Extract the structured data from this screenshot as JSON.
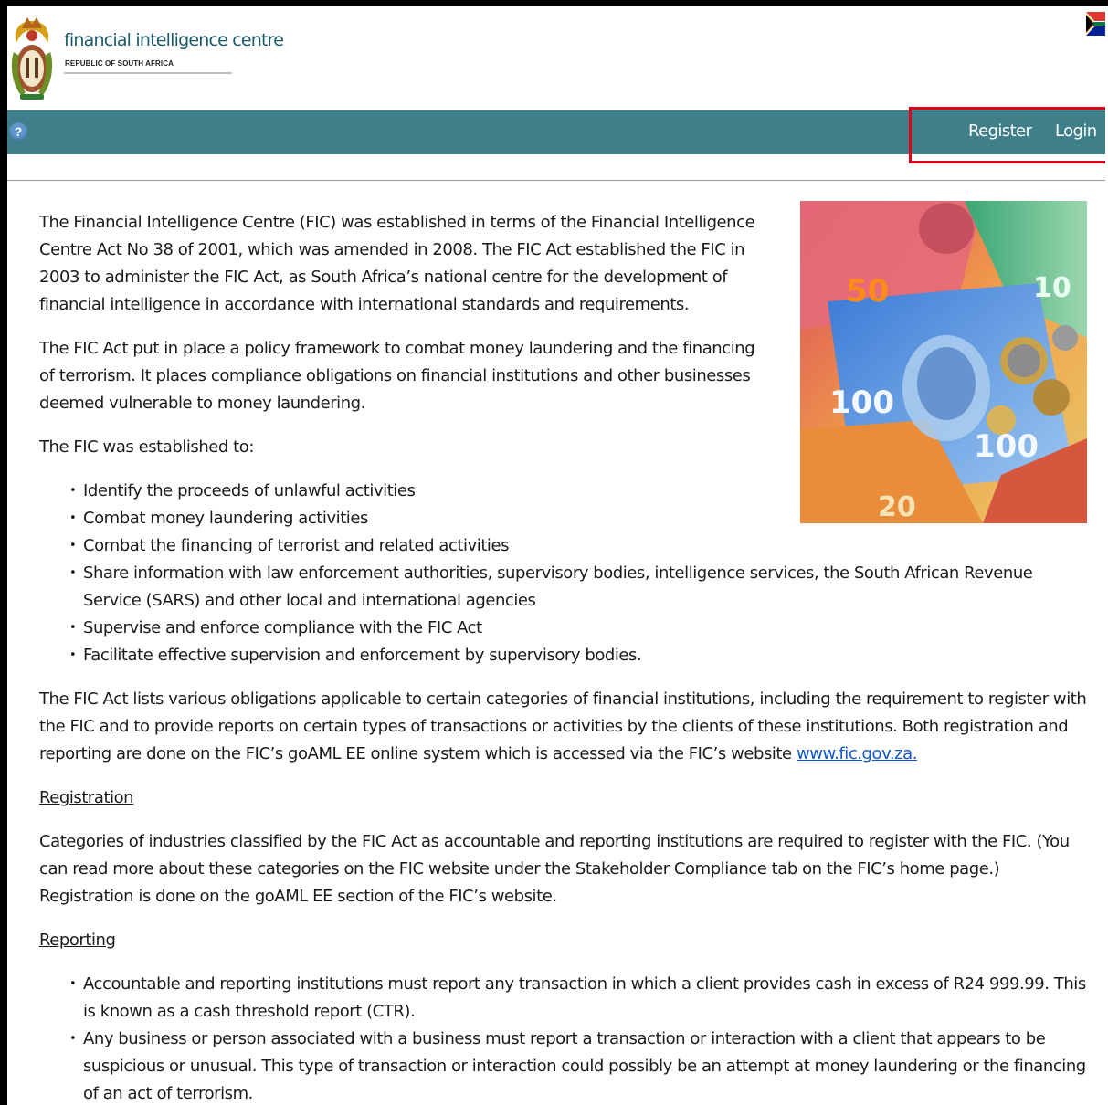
{
  "header": {
    "brand_name": "financial intelligence centre",
    "brand_sub": "REPUBLIC OF SOUTH AFRICA"
  },
  "nav": {
    "help_label": "?",
    "register_label": "Register",
    "login_label": "Login"
  },
  "intro": {
    "para1": "The Financial Intelligence Centre (FIC) was established in terms of the Financial Intelligence Centre Act No 38 of 2001, which was amended in 2008. The FIC Act established the FIC in 2003 to administer the FIC Act, as South Africa’s national centre for the development of financial intelligence in accordance with international standards and requirements.",
    "para2": "The FIC Act put in place a policy framework to combat money laundering and the financing of terrorism. It places compliance obligations on financial institutions and other businesses deemed vulnerable to money laundering.",
    "para3": "The FIC was established to:"
  },
  "purposes": [
    "Identify the proceeds of unlawful activities",
    "Combat money laundering activities",
    "Combat the financing of terrorist and related activities",
    "Share information with law enforcement authorities, supervisory bodies, intelligence services, the South African Revenue Service (SARS) and other local and international agencies",
    "Supervise and enforce compliance with the FIC Act",
    "Facilitate effective supervision and enforcement by supervisory bodies."
  ],
  "obligations": {
    "text": "The FIC Act lists various obligations applicable to certain categories of financial institutions, including the requirement to register with the FIC and to provide reports on certain types of transactions or activities by the clients of these institutions. Both registration and reporting are done on the FIC’s goAML EE online system which is accessed via the FIC’s website ",
    "link_text": "www.fic.gov.za."
  },
  "registration": {
    "heading": "Registration",
    "text": "Categories of industries classified by the FIC Act as accountable and reporting institutions are required to register with the FIC. (You can read more about these categories on the FIC website under the Stakeholder Compliance tab on the FIC’s home page.) Registration is done on the goAML EE section of the FIC’s website."
  },
  "reporting": {
    "heading": "Reporting",
    "items": [
      "Accountable and reporting institutions must report any transaction in which a client provides cash in excess of R24 999.99. This is known as a cash threshold report (CTR).",
      "Any business or person associated with a business must report a transaction or interaction with a client that appears to be suspicious or unusual. This type of transaction or interaction could possibly be an attempt at money laundering or the financing of an act of terrorism."
    ]
  },
  "hero": {
    "note_values": [
      "50",
      "100",
      "100",
      "20",
      "10"
    ]
  },
  "colors": {
    "navbar": "#3f7f8a",
    "highlight_border": "#e3001b",
    "link": "#1155cc"
  }
}
